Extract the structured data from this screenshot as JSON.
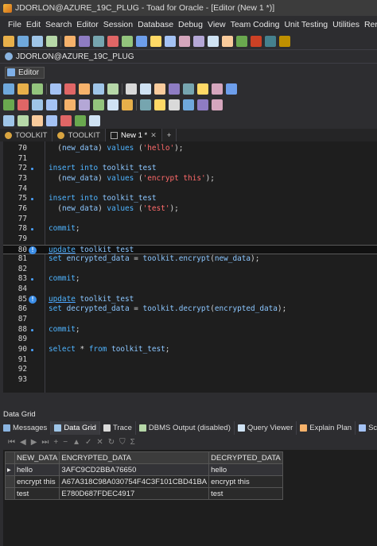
{
  "window": {
    "title": "JDORLON@AZURE_19C_PLUG - Toad for Oracle - [Editor (New 1 *)]"
  },
  "menu": [
    "File",
    "Edit",
    "Search",
    "Editor",
    "Session",
    "Database",
    "Debug",
    "View",
    "Team Coding",
    "Unit Testing",
    "Utilities",
    "Rerun"
  ],
  "connection_tab": "JDORLON@AZURE_19C_PLUG",
  "editor_tab": "Editor",
  "doc_tabs": [
    "TOOLKIT",
    "TOOLKIT",
    "New 1 *",
    "+"
  ],
  "code_lines": [
    {
      "n": "70",
      "marker": "",
      "text": "  (new_data) values ('hello');"
    },
    {
      "n": "71",
      "marker": "",
      "text": ""
    },
    {
      "n": "72",
      "marker": "dot",
      "text": "insert into toolkit_test"
    },
    {
      "n": "73",
      "marker": "",
      "text": "  (new_data) values ('encrypt this');"
    },
    {
      "n": "74",
      "marker": "",
      "text": ""
    },
    {
      "n": "75",
      "marker": "dot",
      "text": "insert into toolkit_test"
    },
    {
      "n": "76",
      "marker": "",
      "text": "  (new_data) values ('test');"
    },
    {
      "n": "77",
      "marker": "",
      "text": ""
    },
    {
      "n": "78",
      "marker": "dot",
      "text": "commit;"
    },
    {
      "n": "79",
      "marker": "",
      "text": ""
    },
    {
      "n": "80",
      "marker": "info",
      "text": "update toolkit_test"
    },
    {
      "n": "81",
      "marker": "",
      "text": "set encrypted_data = toolkit.encrypt(new_data);"
    },
    {
      "n": "82",
      "marker": "",
      "text": ""
    },
    {
      "n": "83",
      "marker": "dot",
      "text": "commit;"
    },
    {
      "n": "84",
      "marker": "",
      "text": ""
    },
    {
      "n": "85",
      "marker": "info",
      "text": "update toolkit_test"
    },
    {
      "n": "86",
      "marker": "",
      "text": "set decrypted_data = toolkit.decrypt(encrypted_data);"
    },
    {
      "n": "87",
      "marker": "",
      "text": ""
    },
    {
      "n": "88",
      "marker": "dot",
      "text": "commit;"
    },
    {
      "n": "89",
      "marker": "",
      "text": ""
    },
    {
      "n": "90",
      "marker": "dot",
      "text": "select * from toolkit_test;"
    },
    {
      "n": "91",
      "marker": "",
      "text": ""
    },
    {
      "n": "92",
      "marker": "",
      "text": ""
    },
    {
      "n": "93",
      "marker": "",
      "text": ""
    }
  ],
  "panel": {
    "title": "Data Grid",
    "tabs": [
      "Messages",
      "Data Grid",
      "Trace",
      "DBMS Output (disabled)",
      "Query Viewer",
      "Explain Plan",
      "Script Output"
    ],
    "active_tab": "Data Grid"
  },
  "grid": {
    "columns": [
      "NEW_DATA",
      "ENCRYPTED_DATA",
      "DECRYPTED_DATA"
    ],
    "rows": [
      [
        "hello",
        "3AFC9CD2BBA76650",
        "hello"
      ],
      [
        "encrypt this",
        "A67A318C98A030754F4C3F101CBD41BA",
        "encrypt this"
      ],
      [
        "test",
        "E780D687FDEC4917",
        "test"
      ]
    ]
  },
  "colors": {
    "accent": "#4aa3ff",
    "keyword": "#4fb4ff",
    "string": "#ff6a6a",
    "background": "#1e1e1e"
  }
}
